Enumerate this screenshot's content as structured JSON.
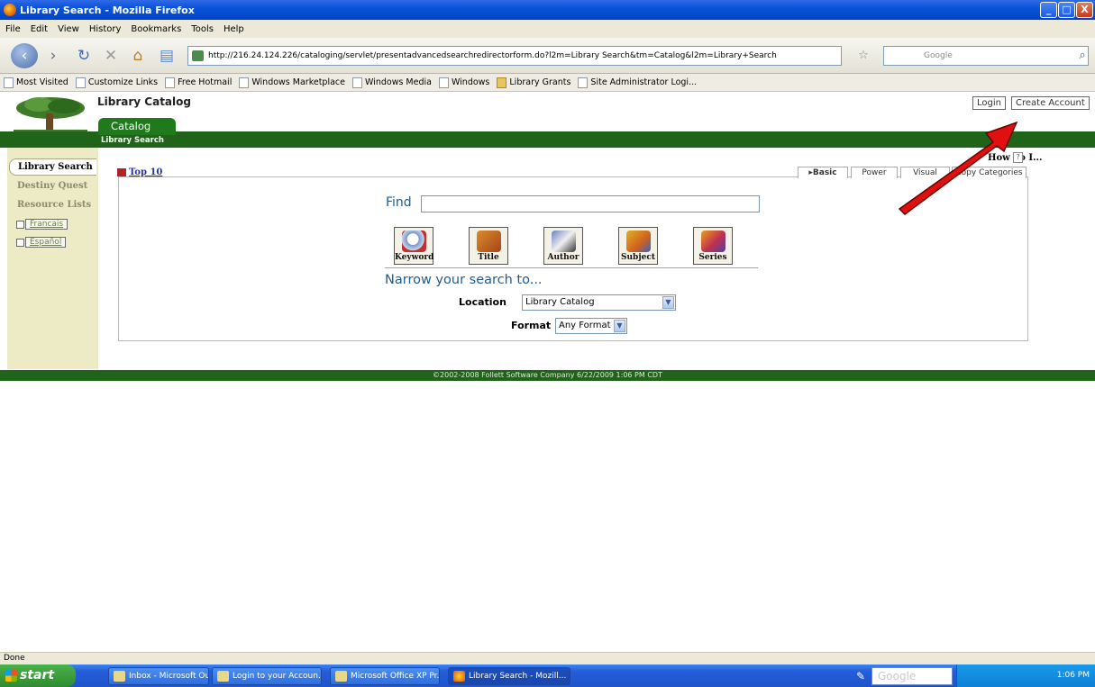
{
  "window": {
    "title": "Library Search - Mozilla Firefox",
    "min": "_",
    "max": "□",
    "close": "X"
  },
  "menu": [
    "File",
    "Edit",
    "View",
    "History",
    "Bookmarks",
    "Tools",
    "Help"
  ],
  "nav": {
    "url": "http://216.24.124.226/cataloging/servlet/presentadvancedsearchredirectorform.do?l2m=Library Search&tm=Catalog&l2m=Library+Search",
    "search_placeholder": "Google"
  },
  "bookmarks": [
    "Most Visited",
    "Customize Links",
    "Free Hotmail",
    "Windows Marketplace",
    "Windows Media",
    "Windows",
    "Library Grants",
    "Site Administrator Logi..."
  ],
  "header": {
    "app_title": "Library Catalog",
    "login": "Login",
    "create_account": "Create Account",
    "catalog_tab": "Catalog",
    "subnav": "Library Search"
  },
  "sidebar": {
    "active": "Library Search",
    "items": [
      "Destiny Quest",
      "Resource Lists"
    ],
    "languages": [
      "Francais",
      "Español"
    ]
  },
  "main": {
    "top10": "Top 10",
    "how_do_i": "How do I...",
    "help": "?",
    "tabs": [
      "▸Basic",
      "Power",
      "Visual",
      "Copy Categories"
    ],
    "find_label": "Find",
    "find_value": "",
    "search_buttons": [
      "Keyword",
      "Title",
      "Author",
      "Subject",
      "Series"
    ],
    "narrow": "Narrow your search to...",
    "location_label": "Location",
    "location_value": "Library Catalog",
    "format_label": "Format",
    "format_value": "Any Format"
  },
  "footer": "©2002-2008  Follett Software Company    6/22/2009 1:06 PM CDT",
  "status": "Done",
  "taskbar": {
    "start": "start",
    "items": [
      "Inbox - Microsoft Out...",
      "Login to your Accoun...",
      "Microsoft Office XP Pr...",
      "Library Search - Mozill..."
    ],
    "google": "Google",
    "clock": "1:06 PM"
  },
  "colors": {
    "brand_green": "#1f6419",
    "link_blue": "#2530a0",
    "arrow": "#e01010"
  }
}
